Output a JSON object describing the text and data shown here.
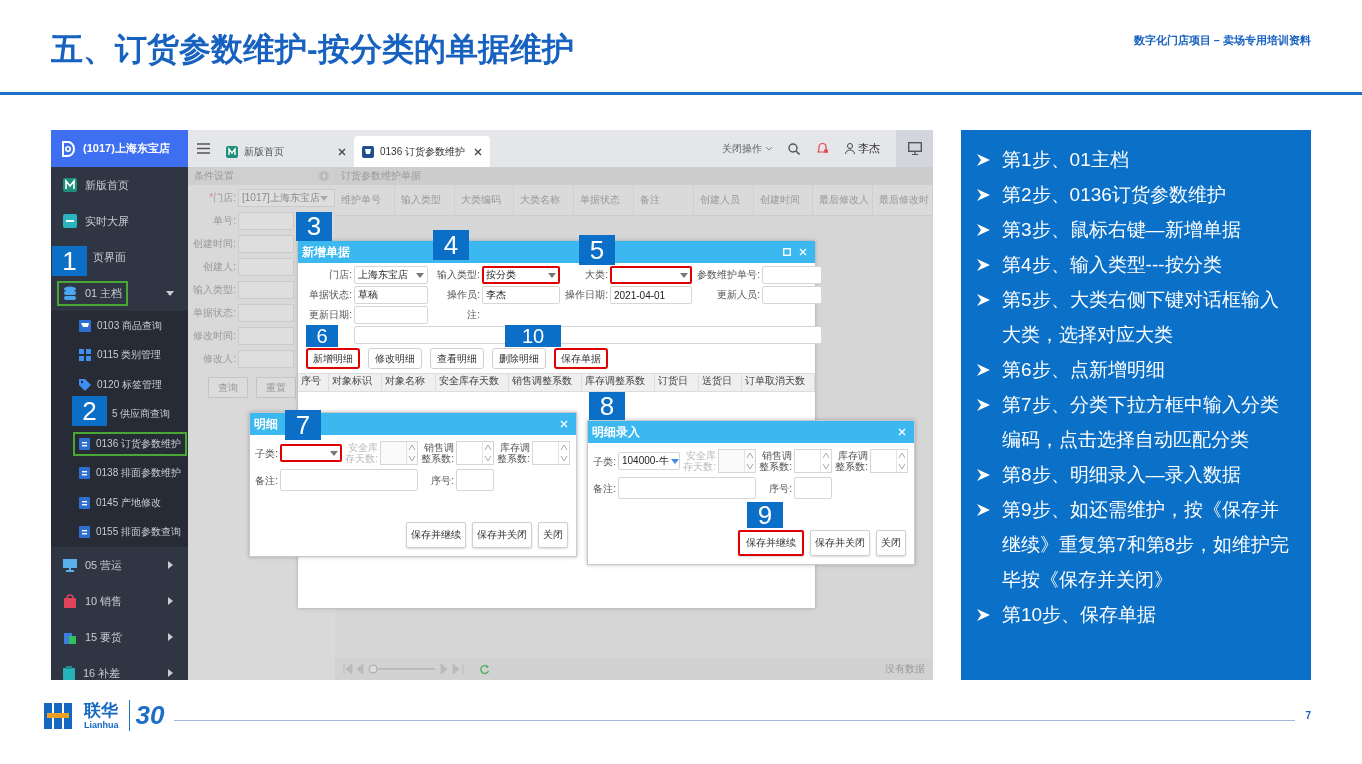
{
  "slide": {
    "title": "五、订货参数维护-按分类的单据维护",
    "subtitle": "数字化门店项目 – 卖场专用培训资料",
    "page": "7"
  },
  "logo": {
    "name": "联华",
    "latin": "Lianhua",
    "anniversary": "30"
  },
  "app": {
    "store": "(1017)上海东宝店",
    "sidebar": [
      {
        "label": "新版首页",
        "marked": false
      },
      {
        "label": "实时大屏",
        "marked": false
      },
      {
        "label": "页界面",
        "marked": false
      },
      {
        "label": "01 主档",
        "marked": true,
        "expanded": true,
        "children": [
          {
            "label": "0103 商品查询",
            "marked": false
          },
          {
            "label": "0115 类别管理",
            "marked": false
          },
          {
            "label": "0120 标签管理",
            "marked": false
          },
          {
            "label": "5 供应商查询",
            "marked": false
          },
          {
            "label": "0136 订货参数维护",
            "marked": true
          },
          {
            "label": "0138 排面参数维护",
            "marked": false
          },
          {
            "label": "0145 产地修改",
            "marked": false
          },
          {
            "label": "0155 排面参数查询",
            "marked": false
          }
        ]
      },
      {
        "label": "05 营运",
        "marked": false,
        "expanded": false
      },
      {
        "label": "10 销售",
        "marked": false,
        "expanded": false
      },
      {
        "label": "15 要货",
        "marked": false,
        "expanded": false
      },
      {
        "label": "16 补差",
        "marked": false,
        "expanded": false
      }
    ],
    "tabs": [
      {
        "label": "新版首页",
        "selected": false
      },
      {
        "label": "0136 订货参数维护",
        "selected": true
      }
    ],
    "toolbar": {
      "close_menu": "关闭操作",
      "user": "李杰"
    },
    "filter": {
      "title": "条件设置",
      "fields": [
        {
          "label": "门店:",
          "required_mark": "*",
          "kind": "select",
          "value": "[1017]上海东宝店"
        },
        {
          "label": "单号:",
          "kind": "text"
        },
        {
          "label": "创建时间:",
          "kind": "text"
        },
        {
          "label": "创建人:",
          "kind": "text"
        },
        {
          "label": "输入类型:",
          "kind": "text"
        },
        {
          "label": "单据状态:",
          "kind": "text"
        },
        {
          "label": "修改时间:",
          "kind": "text"
        },
        {
          "label": "修改人:",
          "kind": "text"
        }
      ],
      "buttons": [
        "查询",
        "重置"
      ]
    },
    "list": {
      "title": "订货参数维护单据",
      "columns": [
        "维护单号",
        "输入类型",
        "大类编码",
        "大类名称",
        "单据状态",
        "备注",
        "创建人员",
        "创建时间",
        "最后修改人",
        "最后修改时"
      ],
      "pager_text": "没有数据"
    },
    "dialog": {
      "title": "新增单据",
      "fields": [
        {
          "label": "门店:",
          "kind": "select",
          "value": "上海东宝店",
          "annotated": false
        },
        {
          "label": "输入类型:",
          "kind": "select",
          "value": "按分类",
          "annotated": true
        },
        {
          "label": "大类:",
          "kind": "select",
          "annotated": true
        },
        {
          "label": "参数维护单号:",
          "kind": "text",
          "annotated": false
        },
        {
          "label": "单据状态:",
          "kind": "text",
          "value": "草稿",
          "annotated": false
        },
        {
          "label": "操作员:",
          "kind": "text",
          "value": "李杰",
          "annotated": false
        },
        {
          "label": "操作日期:",
          "kind": "text",
          "value": "2021-04-01",
          "annotated": false
        },
        {
          "label": "更新人员:",
          "kind": "text",
          "annotated": false
        },
        {
          "label": "更新日期:",
          "kind": "text",
          "annotated": false
        },
        {
          "label": "注:",
          "kind": "memo",
          "annotated": false
        }
      ],
      "buttons": [
        {
          "label": "新增明细",
          "annotated": true
        },
        {
          "label": "修改明细",
          "annotated": false
        },
        {
          "label": "查看明细",
          "annotated": false
        },
        {
          "label": "删除明细",
          "annotated": false
        },
        {
          "label": "保存单据",
          "annotated": true
        }
      ],
      "columns": [
        "序号",
        "对象标识",
        "对象名称",
        "安全库存天数",
        "销售调整系数",
        "库存调整系数",
        "订货日",
        "送货日",
        "订单取消天数"
      ]
    },
    "detail_dialogs": [
      {
        "title": "明细",
        "fields": [
          {
            "label": "子类:",
            "kind": "select",
            "annotated": true,
            "disabled": false
          },
          {
            "label": "安全库存天数:",
            "kind": "spinner",
            "annotated": false,
            "disabled": true
          },
          {
            "label": "销售调整系数:",
            "kind": "spinner",
            "annotated": false,
            "disabled": false
          },
          {
            "label": "库存调整系数:",
            "kind": "spinner",
            "annotated": false,
            "disabled": false
          },
          {
            "label": "备注:",
            "kind": "wide",
            "annotated": false,
            "disabled": false
          },
          {
            "label": "序号:",
            "kind": "text",
            "annotated": false,
            "disabled": false
          }
        ],
        "buttons": [
          {
            "label": "保存并继续",
            "annotated": false
          },
          {
            "label": "保存并关闭",
            "annotated": false
          },
          {
            "label": "关闭",
            "annotated": false
          }
        ]
      },
      {
        "title": "明细录入",
        "fields": [
          {
            "label": "子类:",
            "kind": "select",
            "value": "104000-牛",
            "annotated": false,
            "disabled": false
          },
          {
            "label": "安全库存天数:",
            "kind": "spinner",
            "annotated": false,
            "disabled": true
          },
          {
            "label": "销售调整系数:",
            "kind": "spinner",
            "annotated": false,
            "disabled": false
          },
          {
            "label": "库存调整系数:",
            "kind": "spinner",
            "annotated": false,
            "disabled": false
          },
          {
            "label": "备注:",
            "kind": "wide",
            "annotated": false,
            "disabled": false
          },
          {
            "label": "序号:",
            "kind": "text",
            "annotated": false,
            "disabled": false
          }
        ],
        "buttons": [
          {
            "label": "保存并继续",
            "annotated": true
          },
          {
            "label": "保存并关闭",
            "annotated": false
          },
          {
            "label": "关闭",
            "annotated": false
          }
        ]
      }
    ],
    "callouts": [
      "1",
      "2",
      "3",
      "4",
      "5",
      "6",
      "7",
      "8",
      "9",
      "10"
    ]
  },
  "steps": [
    "第1步、01主档",
    "第2步、0136订货参数维护",
    "第3步、鼠标右键—新增单据",
    "第4步、输入类型---按分类",
    "第5步、大类右侧下键对话框输入大类，选择对应大类",
    "第6步、点新增明细",
    "第7步、分类下拉方框中输入分类编码，点击选择自动匹配分类",
    "第8步、明细录入—录入数据",
    "第9步、如还需维护，按《保存并继续》重复第7和第8步，如维护完毕按《保存并关闭》",
    "第10步、保存单据"
  ]
}
